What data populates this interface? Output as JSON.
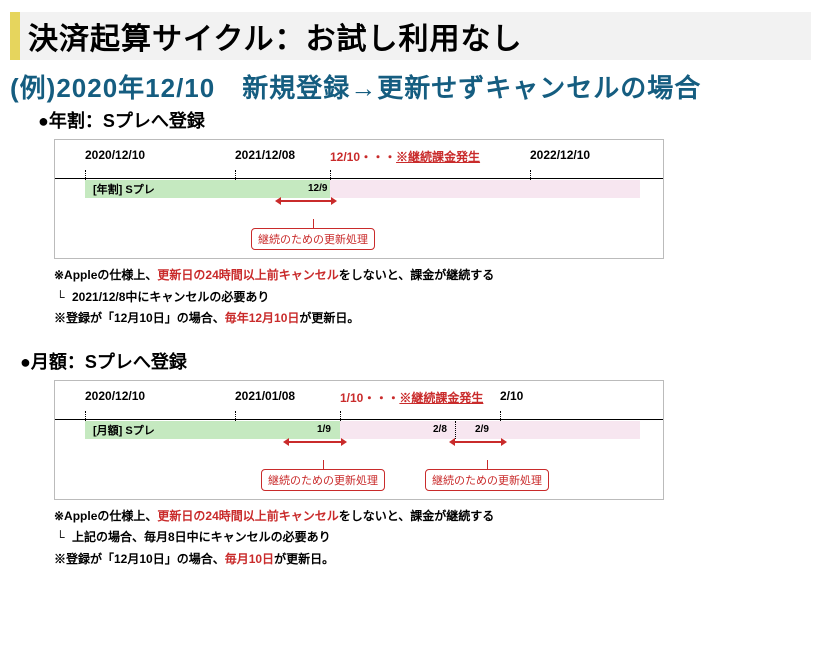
{
  "title": "決済起算サイクル：お試し利用なし",
  "example": "(例)2020年12/10　新規登録→更新せずキャンセルの場合",
  "sections": {
    "annual": {
      "heading": "●年割：Sプレへ登録",
      "ticks": {
        "start": "2020/12/10",
        "renewalEve": "2021/12/08",
        "miniDate": "12/9",
        "renewal": "12/10",
        "billingNote": "※継続課金発生",
        "next": "2022/12/10"
      },
      "barLabel": "[年割] Sプレ",
      "callout": "継続のための更新処理",
      "notes": {
        "l1a": "※Appleの仕様上、",
        "l1b": "更新日の24時間以上前キャンセル",
        "l1c": "をしないと、課金が継続する",
        "l2": "2021/12/8中にキャンセルの必要あり",
        "l3a": "※登録が「12月10日」の場合、",
        "l3b": "毎年12月10日",
        "l3c": "が更新日。"
      }
    },
    "monthly": {
      "heading": "●月額：Sプレへ登録",
      "ticks": {
        "start": "2020/12/10",
        "renewalEve": "2021/01/08",
        "mini1": "1/9",
        "renewal": "1/10",
        "billingNote": "※継続課金発生",
        "mini2a": "2/8",
        "mini2b": "2/9",
        "next": "2/10"
      },
      "barLabel": "[月額] Sプレ",
      "callout1": "継続のための更新処理",
      "callout2": "継続のための更新処理",
      "notes": {
        "l1a": "※Appleの仕様上、",
        "l1b": "更新日の24時間以上前キャンセル",
        "l1c": "をしないと、課金が継続する",
        "l2": "上記の場合、毎月8日中にキャンセルの必要あり",
        "l3a": "※登録が「12月10日」の場合、",
        "l3b": "毎月10日",
        "l3c": "が更新日。"
      }
    }
  }
}
